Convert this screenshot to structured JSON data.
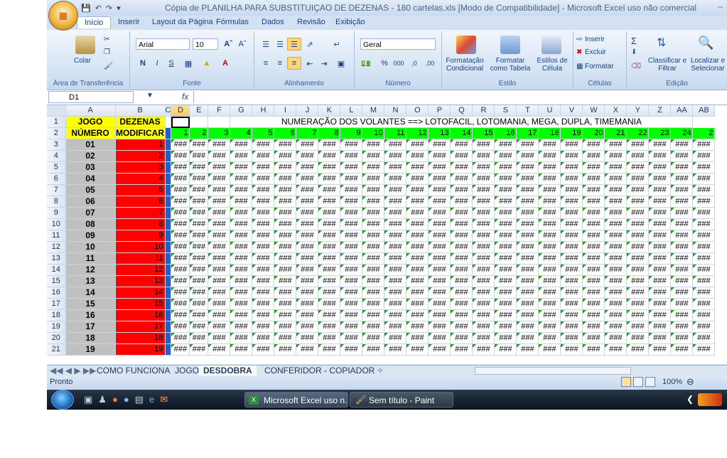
{
  "window": {
    "title": "Cópia de PLANILHA PARA SUBSTITUIÇAO DE DEZENAS - 180 cartelas.xls  [Modo de Compatibilidade] - Microsoft Excel uso não comercial",
    "minimize": "–"
  },
  "tabs": [
    "Início",
    "Inserir",
    "Layout da Página",
    "Fórmulas",
    "Dados",
    "Revisão",
    "Exibição"
  ],
  "ribbon": {
    "clipboard": {
      "paste": "Colar",
      "label": "Área de Transferência"
    },
    "font": {
      "name": "Arial",
      "size": "10",
      "label": "Fonte",
      "bold": "N",
      "italic": "I",
      "underline": "S"
    },
    "alignment": {
      "label": "Alinhamento"
    },
    "number": {
      "format": "Geral",
      "label": "Número",
      "percent": "%",
      "thousands": "000",
      "dec_inc": ",0",
      "dec_dec": ",00"
    },
    "styles": {
      "label": "Estilo",
      "cond": "Formatação Condicional",
      "table": "Formatar como Tabela",
      "cell": "Estilos de Célula"
    },
    "cells": {
      "label": "Células",
      "insert": "Inserir",
      "delete": "Excluir",
      "format": "Formatar"
    },
    "editing": {
      "label": "Edição",
      "sigma": "Σ",
      "sort": "Classificar e Filtrar",
      "find": "Localizar e Selecionar"
    }
  },
  "formula_bar": {
    "name_box": "D1",
    "fx": "fx"
  },
  "columns": [
    "A",
    "B",
    "C",
    "D",
    "E",
    "F",
    "G",
    "H",
    "I",
    "J",
    "K",
    "L",
    "M",
    "N",
    "O",
    "P",
    "Q",
    "R",
    "S",
    "T",
    "U",
    "V",
    "W",
    "X",
    "Y",
    "Z",
    "AA",
    "AB"
  ],
  "row1": {
    "jogo": "JOGO",
    "dezenas": "DEZENAS",
    "banner": "NUMERAÇÃO DOS VOLANTES ==> LOTOFACIL, LOTOMANIA, MEGA, DUPLA, TIMEMANIA"
  },
  "row2": {
    "numero": "NÚMERO",
    "modificar": "MODIFICAR",
    "numbers": [
      "1",
      "2",
      "3",
      "4",
      "5",
      "6",
      "7",
      "8",
      "9",
      "10",
      "11",
      "12",
      "13",
      "14",
      "15",
      "16",
      "17",
      "18",
      "19",
      "20",
      "21",
      "22",
      "23",
      "24",
      "2"
    ]
  },
  "rows": [
    {
      "row": "3",
      "game": "01",
      "mod": "1"
    },
    {
      "row": "4",
      "game": "02",
      "mod": "2"
    },
    {
      "row": "5",
      "game": "03",
      "mod": "3"
    },
    {
      "row": "6",
      "game": "04",
      "mod": "4"
    },
    {
      "row": "7",
      "game": "05",
      "mod": "5"
    },
    {
      "row": "8",
      "game": "06",
      "mod": "6"
    },
    {
      "row": "9",
      "game": "07",
      "mod": "7"
    },
    {
      "row": "10",
      "game": "08",
      "mod": "8"
    },
    {
      "row": "11",
      "game": "09",
      "mod": "9"
    },
    {
      "row": "12",
      "game": "10",
      "mod": "10"
    },
    {
      "row": "13",
      "game": "11",
      "mod": "11"
    },
    {
      "row": "14",
      "game": "12",
      "mod": "12"
    },
    {
      "row": "15",
      "game": "13",
      "mod": "13"
    },
    {
      "row": "16",
      "game": "14",
      "mod": "14"
    },
    {
      "row": "17",
      "game": "15",
      "mod": "15"
    },
    {
      "row": "18",
      "game": "16",
      "mod": "16"
    },
    {
      "row": "19",
      "game": "17",
      "mod": "17"
    },
    {
      "row": "20",
      "game": "18",
      "mod": "18"
    },
    {
      "row": "21",
      "game": "19",
      "mod": "19"
    }
  ],
  "cell_overflow": "###",
  "sheet_tabs": [
    "COMO FUNCIONA",
    "JOGO",
    "DESDOBRA",
    "CONFERIDOR - COPIADOR"
  ],
  "active_sheet": "DESDOBRA",
  "status": {
    "ready": "Pronto",
    "zoom": "100%"
  },
  "taskbar": {
    "excel": "Microsoft Excel uso n...",
    "paint": "Sem título - Paint"
  },
  "colors": {
    "jogo_yellow": "#ffff00",
    "mod_red": "#ff0000",
    "green_band": "#00ff00",
    "gray_cell": "#c0c0c0",
    "blue_marker": "#1f5fd0"
  }
}
